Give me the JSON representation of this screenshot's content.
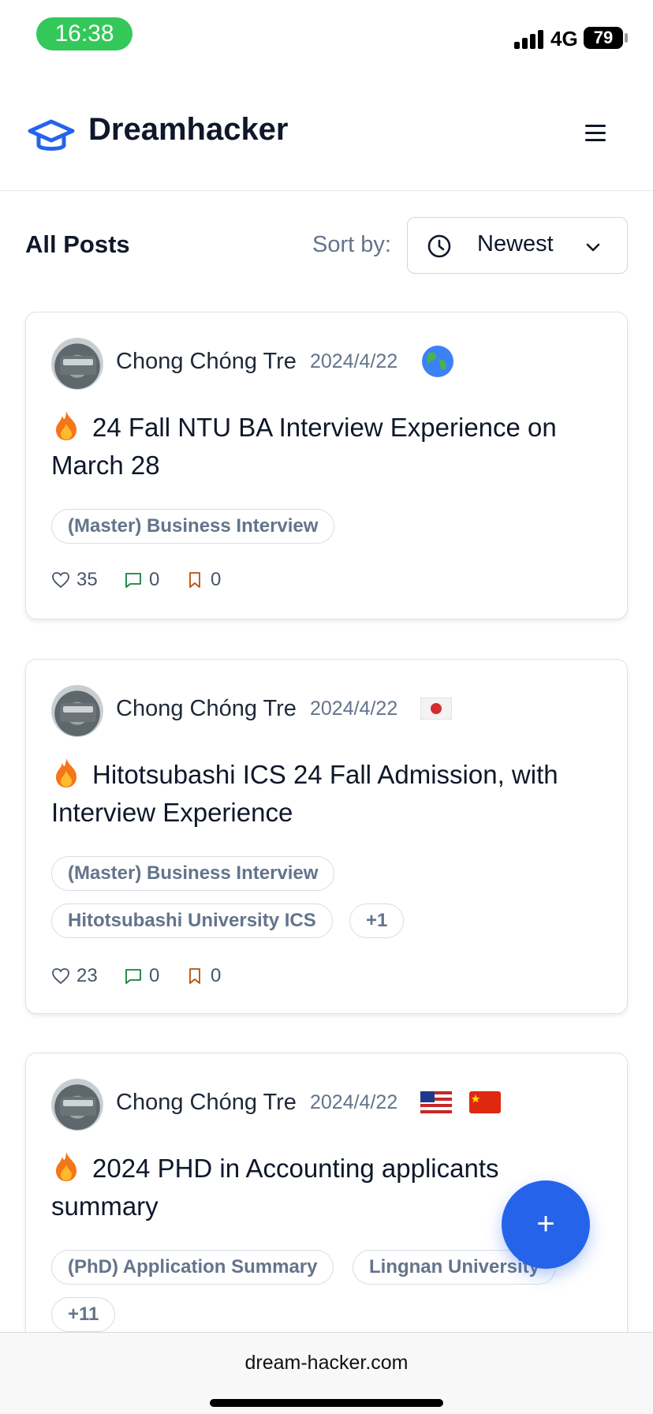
{
  "status_bar": {
    "time": "16:38",
    "network": "4G",
    "battery": "79"
  },
  "header": {
    "brand": "Dreamhacker",
    "logo_icon": "graduation-cap-icon",
    "menu_icon": "hamburger-menu-icon"
  },
  "toolbar": {
    "title": "All Posts",
    "sort_label": "Sort by:",
    "sort_value": "Newest"
  },
  "posts": [
    {
      "author": "Chong Chóng Tre",
      "date": "2024/4/22",
      "flags": [
        "globe-icon"
      ],
      "title": "24 Fall NTU BA Interview Experience on March 28",
      "tags": [
        "(Master) Business Interview"
      ],
      "likes": "35",
      "comments": "0",
      "bookmarks": "0"
    },
    {
      "author": "Chong Chóng Tre",
      "date": "2024/4/22",
      "flags": [
        "japan-flag-icon"
      ],
      "title": "Hitotsubashi ICS 24 Fall Admission, with Interview Experience",
      "tags": [
        "(Master) Business Interview",
        "Hitotsubashi University ICS",
        "+1"
      ],
      "likes": "23",
      "comments": "0",
      "bookmarks": "0"
    },
    {
      "author": "Chong Chóng Tre",
      "date": "2024/4/22",
      "flags": [
        "usa-flag-icon",
        "china-flag-icon"
      ],
      "title": "2024 PHD in Accounting applicants summary",
      "tags": [
        "(PhD) Application Summary",
        "Lingnan University",
        "+11"
      ]
    }
  ],
  "fab": {
    "label": "+"
  },
  "browser": {
    "url": "dream-hacker.com"
  },
  "colors": {
    "accent": "#2563eb",
    "time_pill": "#34c759",
    "muted": "#64748b"
  }
}
